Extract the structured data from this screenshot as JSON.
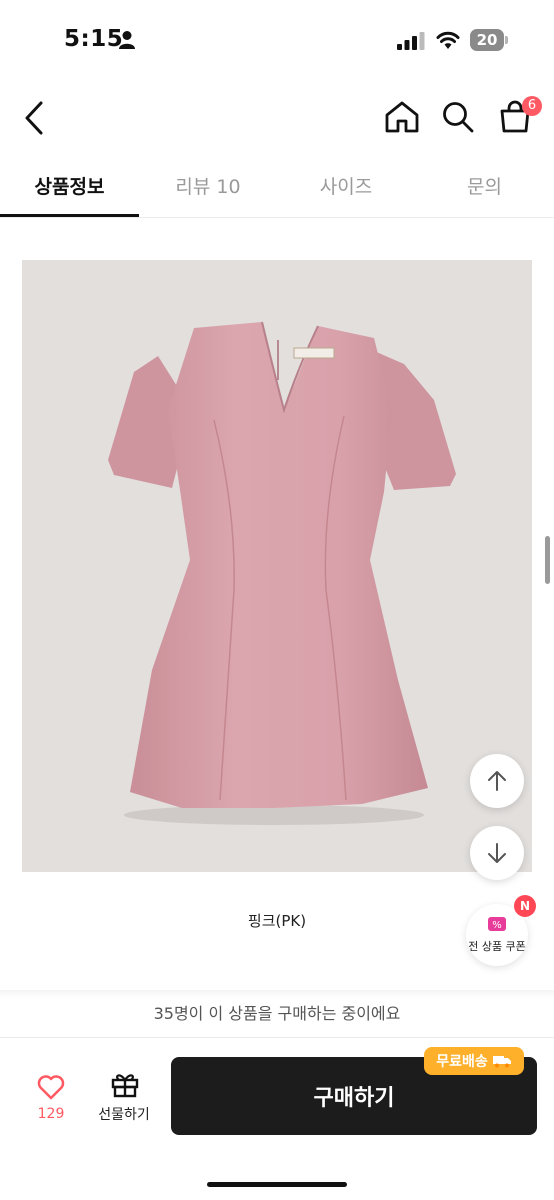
{
  "status": {
    "time": "5:15",
    "battery": "20"
  },
  "header": {
    "cart_count": "6"
  },
  "tabs": [
    {
      "label": "상품정보",
      "active": true
    },
    {
      "label": "리뷰 10",
      "active": false
    },
    {
      "label": "사이즈",
      "active": false
    },
    {
      "label": "문의",
      "active": false
    }
  ],
  "product": {
    "caption": "핑크(PK)",
    "dress_color": "#d9a3ab",
    "background_color": "#e2dfdd"
  },
  "coupon": {
    "badge": "N",
    "label": "전 상품 쿠폰"
  },
  "buyers_message": "35명이 이 상품을 구매하는 중이에요",
  "bottom_bar": {
    "like_count": "129",
    "gift_label": "선물하기",
    "buy_label": "구매하기",
    "free_shipping_label": "무료배송"
  },
  "icons": {
    "back": "back-arrow-icon",
    "home": "home-icon",
    "search": "search-icon",
    "cart": "cart-icon",
    "up": "arrow-up-icon",
    "down": "arrow-down-icon",
    "heart": "heart-icon",
    "gift": "gift-icon",
    "truck": "truck-icon"
  },
  "colors": {
    "accent": "#ff5a63",
    "buy_button": "#1c1c1c",
    "free_shipping": "#ffb02a"
  }
}
